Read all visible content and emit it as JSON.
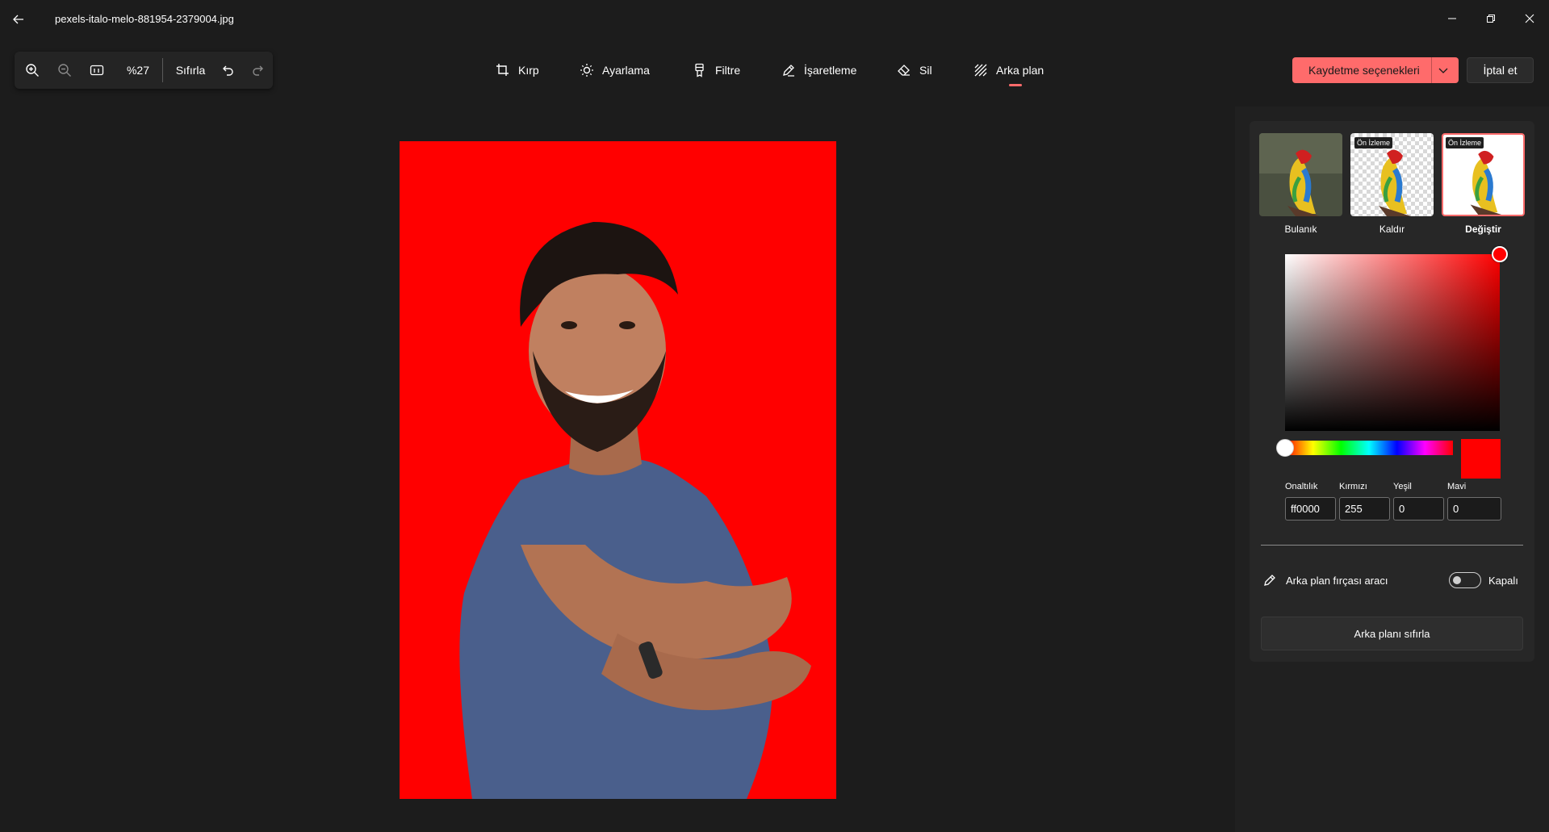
{
  "window": {
    "filename": "pexels-italo-melo-881954-2379004.jpg"
  },
  "zoom_toolbar": {
    "zoom_level": "%27",
    "reset_label": "Sıfırla"
  },
  "tools": [
    {
      "label": "Kırp",
      "icon": "crop-icon"
    },
    {
      "label": "Ayarlama",
      "icon": "brightness-icon"
    },
    {
      "label": "Filtre",
      "icon": "filter-icon"
    },
    {
      "label": "İşaretleme",
      "icon": "pen-icon"
    },
    {
      "label": "Sil",
      "icon": "eraser-icon"
    },
    {
      "label": "Arka plan",
      "icon": "background-icon",
      "active": true
    }
  ],
  "actions": {
    "save_label": "Kaydetme seçenekleri",
    "cancel_label": "İptal et"
  },
  "background_panel": {
    "options": [
      {
        "label": "Bulanık",
        "badge": ""
      },
      {
        "label": "Kaldır",
        "badge": "Ön İzleme"
      },
      {
        "label": "Değiştir",
        "badge": "Ön İzleme",
        "selected": true
      }
    ],
    "color_fields": {
      "hex_label": "Onaltılık",
      "hex_value": "ff0000",
      "red_label": "Kırmızı",
      "red_value": "255",
      "green_label": "Yeşil",
      "green_value": "0",
      "blue_label": "Mavi",
      "blue_value": "0"
    },
    "brush_label": "Arka plan fırçası aracı",
    "brush_state": "Kapalı",
    "reset_label": "Arka planı sıfırla"
  },
  "colors": {
    "accent": "#ff6b6b",
    "selected_color": "#ff0000"
  }
}
